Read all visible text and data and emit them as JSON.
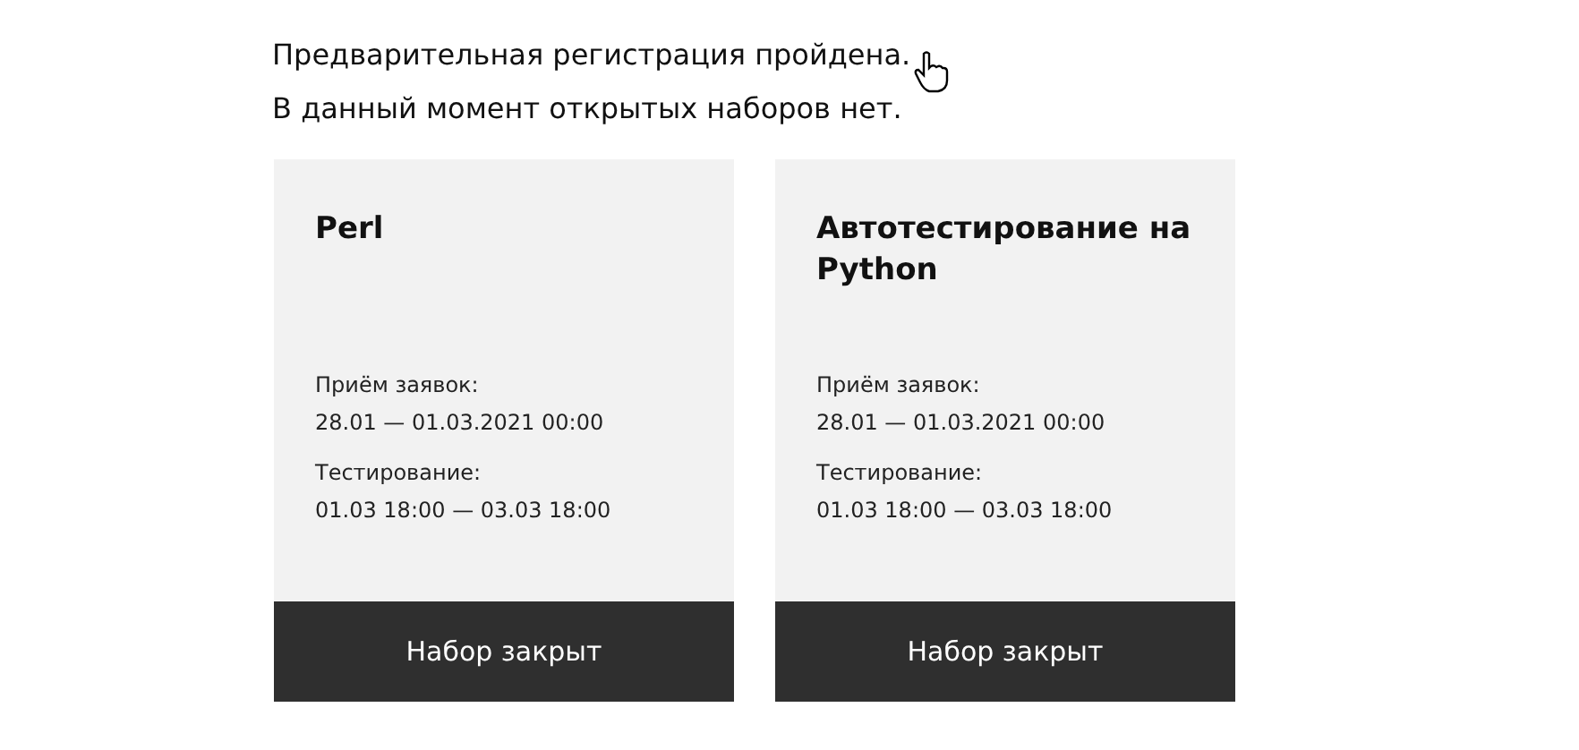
{
  "message": [
    "Предварительная регистрация пройдена.",
    "В данный момент открытых наборов нет."
  ],
  "cards": [
    {
      "title": "Perl",
      "fields": [
        {
          "label": "Приём заявок:",
          "value": "28.01 — 01.03.2021 00:00"
        },
        {
          "label": "Тестирование:",
          "value": "01.03 18:00 — 03.03 18:00"
        }
      ],
      "button": "Набор закрыт"
    },
    {
      "title": "Автотестирование на Python",
      "fields": [
        {
          "label": "Приём заявок:",
          "value": "28.01 — 01.03.2021 00:00"
        },
        {
          "label": "Тестирование:",
          "value": "01.03 18:00 — 03.03 18:00"
        }
      ],
      "button": "Набор закрыт"
    }
  ]
}
